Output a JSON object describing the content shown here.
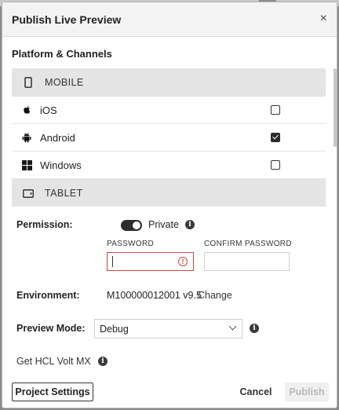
{
  "dialog": {
    "title": "Publish Live Preview",
    "close_glyph": "×"
  },
  "platforms": {
    "section_label": "Platform & Channels",
    "groups": [
      {
        "label": "MOBILE",
        "icon": "mobile-phone-icon",
        "items": [
          {
            "label": "iOS",
            "icon": "apple-icon",
            "checked": false
          },
          {
            "label": "Android",
            "icon": "android-icon",
            "checked": true
          },
          {
            "label": "Windows",
            "icon": "windows-icon",
            "checked": false
          }
        ]
      },
      {
        "label": "TABLET",
        "icon": "tablet-icon",
        "items": []
      }
    ]
  },
  "permission": {
    "label": "Permission:",
    "toggle_on": true,
    "toggle_label": "Private",
    "password_label": "PASSWORD",
    "password_value": "",
    "confirm_label": "CONFIRM PASSWORD",
    "confirm_value": ""
  },
  "environment": {
    "label": "Environment:",
    "value": "M100000012001 v9.5",
    "change_link": "Change"
  },
  "preview_mode": {
    "label": "Preview Mode:",
    "selected": "Debug"
  },
  "get_link": "Get HCL Volt MX",
  "footer": {
    "project_settings": "Project Settings",
    "cancel": "Cancel",
    "publish": "Publish"
  },
  "colors": {
    "error": "#c9463d",
    "group_bg": "#e4e4e4",
    "header_bg": "#f3f3f3"
  }
}
